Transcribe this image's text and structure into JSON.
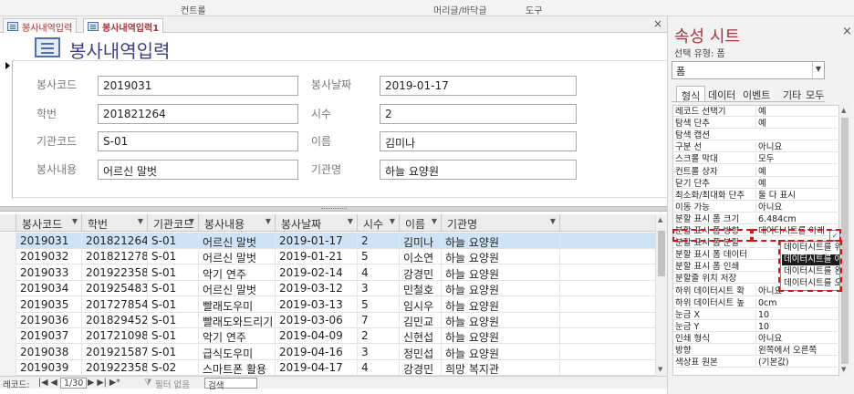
{
  "ribbon": {
    "context_label": "컨트롤",
    "header_footer": "머리글/바닥글",
    "tools": "도구"
  },
  "tabs": [
    {
      "label": "봉사내역입력"
    },
    {
      "label": "봉사내역입력1"
    }
  ],
  "doc_close": "×",
  "form": {
    "title": "봉사내역입력",
    "fields": {
      "service_code": {
        "label": "봉사코드",
        "value": "2019031"
      },
      "service_date": {
        "label": "봉사날짜",
        "value": "2019-01-17"
      },
      "student_id": {
        "label": "학번",
        "value": "201821264"
      },
      "hours": {
        "label": "시수",
        "value": "2"
      },
      "org_code": {
        "label": "기관코드",
        "value": "S-01"
      },
      "name": {
        "label": "이름",
        "value": "김미나"
      },
      "content": {
        "label": "봉사내용",
        "value": "어르신 말벗"
      },
      "org_name": {
        "label": "기관명",
        "value": "하늘 요양원"
      }
    }
  },
  "datasheet": {
    "columns": [
      "봉사코드",
      "학번",
      "기관코드",
      "봉사내용",
      "봉사날짜",
      "시수",
      "이름",
      "기관명"
    ],
    "rows": [
      [
        "2019031",
        "201821264",
        "S-01",
        "어르신 말벗",
        "2019-01-17",
        "2",
        "김미나",
        "하늘 요양원"
      ],
      [
        "2019032",
        "201821278",
        "S-01",
        "어르신 말벗",
        "2019-01-21",
        "5",
        "이소연",
        "하늘 요양원"
      ],
      [
        "2019033",
        "201922358",
        "S-01",
        "악기 연주",
        "2019-02-14",
        "4",
        "강경민",
        "하늘 요양원"
      ],
      [
        "2019034",
        "201925483",
        "S-01",
        "어르신 말벗",
        "2019-03-12",
        "3",
        "민철호",
        "하늘 요양원"
      ],
      [
        "2019035",
        "201727854",
        "S-01",
        "빨래도우미",
        "2019-03-13",
        "5",
        "임시우",
        "하늘 요양원"
      ],
      [
        "2019036",
        "201829452",
        "S-01",
        "빨래도와드리기",
        "2019-03-06",
        "7",
        "김민교",
        "하늘 요양원"
      ],
      [
        "2019037",
        "201721098",
        "S-01",
        "악기 연주",
        "2019-04-09",
        "2",
        "신현섭",
        "하늘 요양원"
      ],
      [
        "2019038",
        "201921587",
        "S-01",
        "급식도우미",
        "2019-04-16",
        "3",
        "정민섭",
        "하늘 요양원"
      ],
      [
        "2019039",
        "201922358",
        "S-02",
        "스마트폰 활용",
        "2019-04-17",
        "4",
        "강경민",
        "희망 복지관"
      ]
    ],
    "selected_row": 0
  },
  "navbar": {
    "record_label": "레코드: ",
    "nav_first_prev": "|◀ ◀",
    "current": "1/30",
    "nav_next_last_new": "▶ ▶| ▶*",
    "filter": "필터 없음",
    "search_placeholder": "검색"
  },
  "property_sheet": {
    "title": "속성 시트",
    "subtitle": "선택 유형: 폼",
    "object": "폼",
    "tabs": [
      "형식",
      "데이터",
      "이벤트",
      "기타",
      "모두"
    ],
    "active_tab": 0,
    "close": "×",
    "properties": [
      [
        "레코드 선택기",
        "예"
      ],
      [
        "탐색 단추",
        "예"
      ],
      [
        "탐색 캡션",
        ""
      ],
      [
        "구분 선",
        "아니요"
      ],
      [
        "스크롤 막대",
        "모두"
      ],
      [
        "컨트롤 상자",
        "예"
      ],
      [
        "닫기 단추",
        "예"
      ],
      [
        "최소화/최대화 단추",
        "둘 다 표시"
      ],
      [
        "이동 가능",
        "아니요"
      ],
      [
        "분할 표시 폼 크기",
        "6.484cm"
      ],
      [
        "분할 표시 폼 방향",
        "데이터시트를 아래"
      ],
      [
        "분할 표시 폼 분할",
        ""
      ],
      [
        "분할 표시 폼 데이터",
        ""
      ],
      [
        "분할 표시 폼 인쇄",
        ""
      ],
      [
        "분할줄 위치 저장",
        ""
      ],
      [
        "하위 데이터시트 확",
        "아니요"
      ],
      [
        "하위 데이터시트 높",
        "0cm"
      ],
      [
        "눈금 X",
        "10"
      ],
      [
        "눈금 Y",
        "10"
      ],
      [
        "인쇄 형식",
        "아니요"
      ],
      [
        "방향",
        "왼쪽에서 오른쪽"
      ],
      [
        "색상표 원본",
        "(기본값)"
      ]
    ],
    "dropdown_options": [
      "데이터시트를 위쪽에",
      "데이터시트를 아래쪽",
      "데이터시트를 왼쪽에",
      "데이터시트를 오른쪽"
    ],
    "dropdown_highlight": 1
  },
  "colors": {
    "accent": "#a4373a",
    "selection": "#cfe3f7",
    "highlight_box": "#dd1111"
  }
}
